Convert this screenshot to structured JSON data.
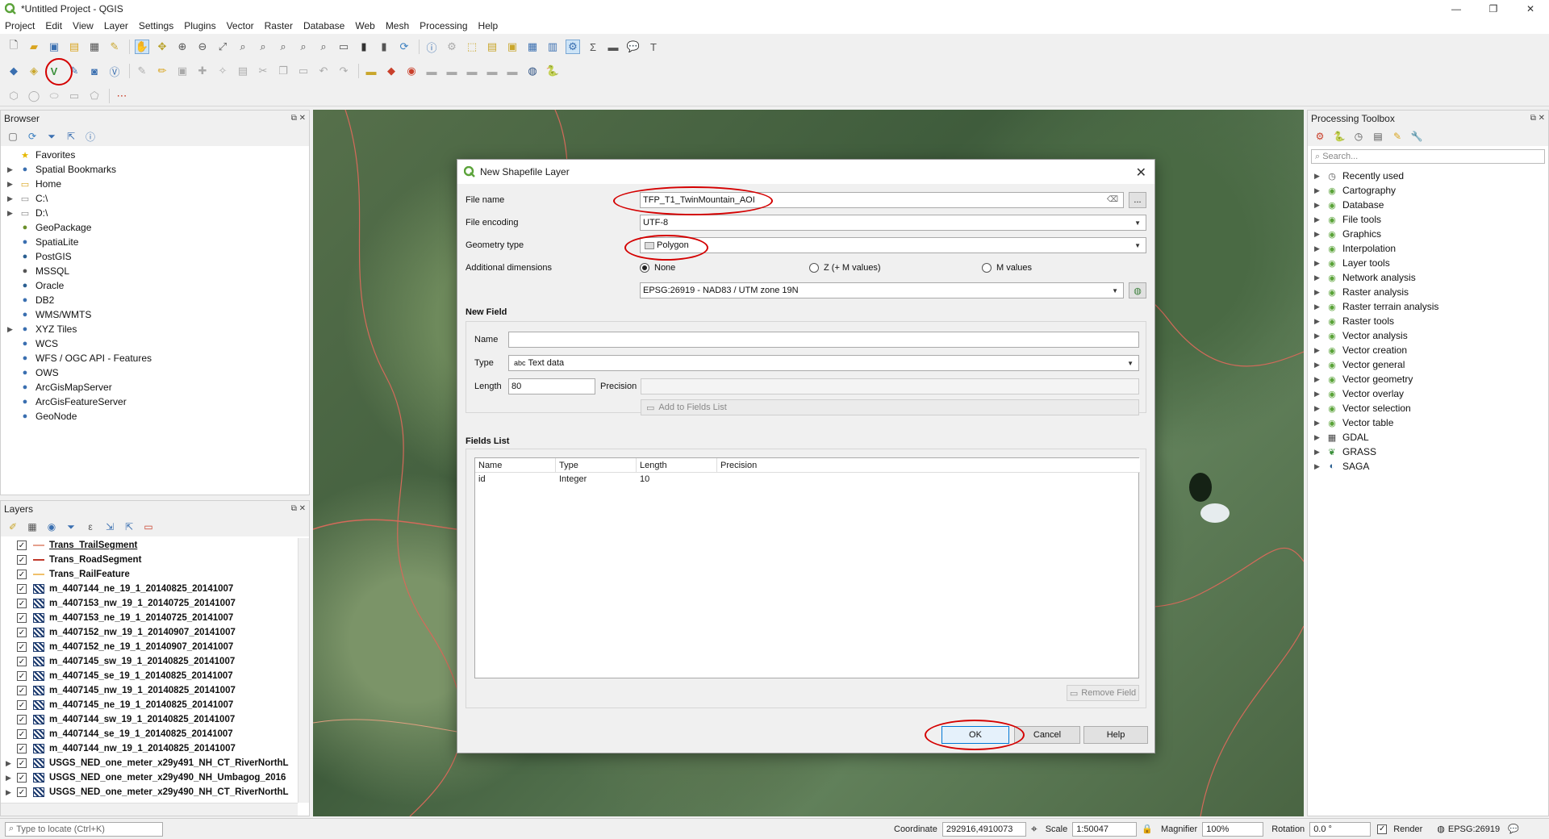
{
  "window": {
    "title": "*Untitled Project - QGIS"
  },
  "menu": [
    "Project",
    "Edit",
    "View",
    "Layer",
    "Settings",
    "Plugins",
    "Vector",
    "Raster",
    "Database",
    "Web",
    "Mesh",
    "Processing",
    "Help"
  ],
  "browser": {
    "title": "Browser",
    "items": [
      {
        "label": "Favorites",
        "icon": "star-icon",
        "arrow": ""
      },
      {
        "label": "Spatial Bookmarks",
        "icon": "bookmark-icon",
        "arrow": "▶"
      },
      {
        "label": "Home",
        "icon": "folder-icon",
        "arrow": "▶"
      },
      {
        "label": "C:\\",
        "icon": "drive-icon",
        "arrow": "▶"
      },
      {
        "label": "D:\\",
        "icon": "drive-icon",
        "arrow": "▶"
      },
      {
        "label": "GeoPackage",
        "icon": "geopackage-icon",
        "arrow": ""
      },
      {
        "label": "SpatiaLite",
        "icon": "spatialite-icon",
        "arrow": ""
      },
      {
        "label": "PostGIS",
        "icon": "postgis-icon",
        "arrow": ""
      },
      {
        "label": "MSSQL",
        "icon": "mssql-icon",
        "arrow": ""
      },
      {
        "label": "Oracle",
        "icon": "oracle-icon",
        "arrow": ""
      },
      {
        "label": "DB2",
        "icon": "db2-icon",
        "arrow": ""
      },
      {
        "label": "WMS/WMTS",
        "icon": "wms-icon",
        "arrow": ""
      },
      {
        "label": "XYZ Tiles",
        "icon": "xyz-icon",
        "arrow": "▶"
      },
      {
        "label": "WCS",
        "icon": "wcs-icon",
        "arrow": ""
      },
      {
        "label": "WFS / OGC API - Features",
        "icon": "wfs-icon",
        "arrow": ""
      },
      {
        "label": "OWS",
        "icon": "ows-icon",
        "arrow": ""
      },
      {
        "label": "ArcGisMapServer",
        "icon": "arcgis-icon",
        "arrow": ""
      },
      {
        "label": "ArcGisFeatureServer",
        "icon": "arcgis-icon",
        "arrow": ""
      },
      {
        "label": "GeoNode",
        "icon": "geonode-icon",
        "arrow": ""
      }
    ]
  },
  "layers": {
    "title": "Layers",
    "items": [
      {
        "label": "Trans_TrailSegment",
        "sym": "line",
        "arrow": ""
      },
      {
        "label": "Trans_RoadSegment",
        "sym": "line2",
        "arrow": ""
      },
      {
        "label": "Trans_RailFeature",
        "sym": "line3",
        "arrow": ""
      },
      {
        "label": "m_4407144_ne_19_1_20140825_20141007",
        "sym": "raster",
        "arrow": ""
      },
      {
        "label": "m_4407153_nw_19_1_20140725_20141007",
        "sym": "raster",
        "arrow": ""
      },
      {
        "label": "m_4407153_ne_19_1_20140725_20141007",
        "sym": "raster",
        "arrow": ""
      },
      {
        "label": "m_4407152_nw_19_1_20140907_20141007",
        "sym": "raster",
        "arrow": ""
      },
      {
        "label": "m_4407152_ne_19_1_20140907_20141007",
        "sym": "raster",
        "arrow": ""
      },
      {
        "label": "m_4407145_sw_19_1_20140825_20141007",
        "sym": "raster",
        "arrow": ""
      },
      {
        "label": "m_4407145_se_19_1_20140825_20141007",
        "sym": "raster",
        "arrow": ""
      },
      {
        "label": "m_4407145_nw_19_1_20140825_20141007",
        "sym": "raster",
        "arrow": ""
      },
      {
        "label": "m_4407145_ne_19_1_20140825_20141007",
        "sym": "raster",
        "arrow": ""
      },
      {
        "label": "m_4407144_sw_19_1_20140825_20141007",
        "sym": "raster",
        "arrow": ""
      },
      {
        "label": "m_4407144_se_19_1_20140825_20141007",
        "sym": "raster",
        "arrow": ""
      },
      {
        "label": "m_4407144_nw_19_1_20140825_20141007",
        "sym": "raster",
        "arrow": ""
      },
      {
        "label": "USGS_NED_one_meter_x29y491_NH_CT_RiverNorthL",
        "sym": "raster",
        "arrow": "▶"
      },
      {
        "label": "USGS_NED_one_meter_x29y490_NH_Umbagog_2016",
        "sym": "raster",
        "arrow": "▶"
      },
      {
        "label": "USGS_NED_one_meter_x29y490_NH_CT_RiverNorthL",
        "sym": "raster",
        "arrow": "▶"
      }
    ]
  },
  "processing": {
    "title": "Processing Toolbox",
    "search_placeholder": "Search...",
    "items": [
      {
        "label": "Recently used",
        "icon": "clock-icon"
      },
      {
        "label": "Cartography",
        "icon": "qgis-icon"
      },
      {
        "label": "Database",
        "icon": "qgis-icon"
      },
      {
        "label": "File tools",
        "icon": "qgis-icon"
      },
      {
        "label": "Graphics",
        "icon": "qgis-icon"
      },
      {
        "label": "Interpolation",
        "icon": "qgis-icon"
      },
      {
        "label": "Layer tools",
        "icon": "qgis-icon"
      },
      {
        "label": "Network analysis",
        "icon": "qgis-icon"
      },
      {
        "label": "Raster analysis",
        "icon": "qgis-icon"
      },
      {
        "label": "Raster terrain analysis",
        "icon": "qgis-icon"
      },
      {
        "label": "Raster tools",
        "icon": "qgis-icon"
      },
      {
        "label": "Vector analysis",
        "icon": "qgis-icon"
      },
      {
        "label": "Vector creation",
        "icon": "qgis-icon"
      },
      {
        "label": "Vector general",
        "icon": "qgis-icon"
      },
      {
        "label": "Vector geometry",
        "icon": "qgis-icon"
      },
      {
        "label": "Vector overlay",
        "icon": "qgis-icon"
      },
      {
        "label": "Vector selection",
        "icon": "qgis-icon"
      },
      {
        "label": "Vector table",
        "icon": "qgis-icon"
      },
      {
        "label": "GDAL",
        "icon": "gdal-icon"
      },
      {
        "label": "GRASS",
        "icon": "grass-icon"
      },
      {
        "label": "SAGA",
        "icon": "saga-icon"
      }
    ]
  },
  "dialog": {
    "title": "New Shapefile Layer",
    "file_name_label": "File name",
    "file_name_value": "TFP_T1_TwinMountain_AOI",
    "browse_label": "...",
    "file_encoding_label": "File encoding",
    "file_encoding_value": "UTF-8",
    "geometry_type_label": "Geometry type",
    "geometry_type_value": "Polygon",
    "additional_dimensions_label": "Additional dimensions",
    "dim_none": "None",
    "dim_zm": "Z (+ M values)",
    "dim_m": "M values",
    "crs_value": "EPSG:26919 - NAD83 / UTM zone 19N",
    "new_field_title": "New Field",
    "name_label": "Name",
    "name_value": "",
    "type_label": "Type",
    "type_value": "Text data",
    "type_prefix": "abc",
    "length_label": "Length",
    "length_value": "80",
    "precision_label": "Precision",
    "precision_value": "",
    "add_to_fields_label": "Add to Fields List",
    "fields_list_title": "Fields List",
    "columns": [
      "Name",
      "Type",
      "Length",
      "Precision"
    ],
    "rows": [
      {
        "name": "id",
        "type": "Integer",
        "length": "10",
        "precision": ""
      }
    ],
    "remove_field_label": "Remove Field",
    "ok_label": "OK",
    "cancel_label": "Cancel",
    "help_label": "Help"
  },
  "status": {
    "locate_placeholder": "Type to locate (Ctrl+K)",
    "coordinate_label": "Coordinate",
    "coordinate_value": "292916,4910073",
    "scale_label": "Scale",
    "scale_value": "1:50047",
    "magnifier_label": "Magnifier",
    "magnifier_value": "100%",
    "rotation_label": "Rotation",
    "rotation_value": "0.0 °",
    "render_label": "Render",
    "crs_label": "EPSG:26919"
  },
  "colors": {
    "annotation": "#d40000",
    "qgis_green": "#5ba33a"
  }
}
